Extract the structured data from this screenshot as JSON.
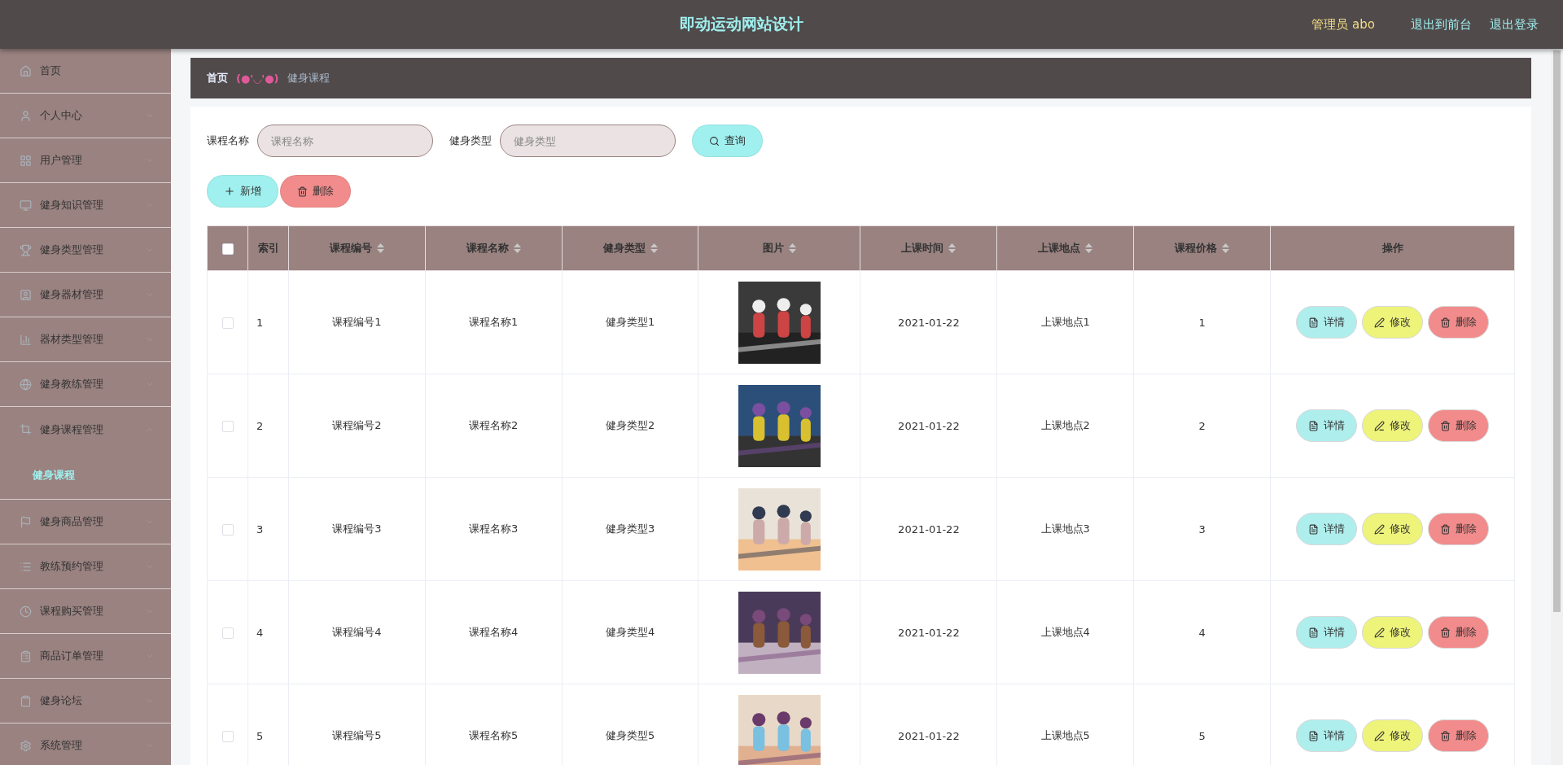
{
  "header": {
    "title": "即动运动网站设计",
    "user": "管理员 abo",
    "links": [
      "退出到前台",
      "退出登录"
    ]
  },
  "sidebar": {
    "items": [
      {
        "label": "首页",
        "kind": "link",
        "expanded": false
      },
      {
        "label": "个人中心",
        "kind": "menu",
        "expanded": false
      },
      {
        "label": "用户管理",
        "kind": "menu",
        "expanded": false
      },
      {
        "label": "健身知识管理",
        "kind": "menu",
        "expanded": false
      },
      {
        "label": "健身类型管理",
        "kind": "menu",
        "expanded": false
      },
      {
        "label": "健身器材管理",
        "kind": "menu",
        "expanded": false
      },
      {
        "label": "器材类型管理",
        "kind": "menu",
        "expanded": false
      },
      {
        "label": "健身教练管理",
        "kind": "menu",
        "expanded": false
      },
      {
        "label": "健身课程管理",
        "kind": "menu",
        "expanded": true,
        "children": [
          {
            "label": "健身课程",
            "selected": true
          }
        ]
      },
      {
        "label": "健身商品管理",
        "kind": "menu",
        "expanded": false
      },
      {
        "label": "教练预约管理",
        "kind": "menu",
        "expanded": false
      },
      {
        "label": "课程购买管理",
        "kind": "menu",
        "expanded": false
      },
      {
        "label": "商品订单管理",
        "kind": "menu",
        "expanded": false
      },
      {
        "label": "健身论坛",
        "kind": "menu",
        "expanded": false
      },
      {
        "label": "系统管理",
        "kind": "menu",
        "expanded": false
      }
    ]
  },
  "breadcrumb": {
    "home": "首页",
    "separator": "(●'◡'●)",
    "current": "健身课程"
  },
  "search": {
    "fields": [
      {
        "label": "课程名称",
        "placeholder": "课程名称"
      },
      {
        "label": "健身类型",
        "placeholder": "健身类型"
      }
    ],
    "button": "查询"
  },
  "toolbar": [
    {
      "label": "新增",
      "kind": "add"
    },
    {
      "label": "删除",
      "kind": "delete"
    }
  ],
  "table": {
    "select_all": {
      "checked": false
    },
    "columns": [
      {
        "label": "索引",
        "sortable": false
      },
      {
        "label": "课程编号",
        "sortable": true
      },
      {
        "label": "课程名称",
        "sortable": true
      },
      {
        "label": "健身类型",
        "sortable": true
      },
      {
        "label": "图片",
        "sortable": true
      },
      {
        "label": "上课时间",
        "sortable": true
      },
      {
        "label": "上课地点",
        "sortable": true
      },
      {
        "label": "课程价格",
        "sortable": true
      },
      {
        "label": "操作",
        "sortable": false
      }
    ],
    "rows": [
      {
        "checked": false,
        "index": "1",
        "code": "课程编号1",
        "name": "课程名称1",
        "type": "健身类型1",
        "time": "2021-01-22",
        "place": "上课地点1",
        "price": "1",
        "actions": [
          {
            "label": "详情",
            "kind": "detail"
          },
          {
            "label": "修改",
            "kind": "edit"
          },
          {
            "label": "删除",
            "kind": "delete"
          }
        ]
      },
      {
        "checked": false,
        "index": "2",
        "code": "课程编号2",
        "name": "课程名称2",
        "type": "健身类型2",
        "time": "2021-01-22",
        "place": "上课地点2",
        "price": "2",
        "actions": [
          {
            "label": "详情",
            "kind": "detail"
          },
          {
            "label": "修改",
            "kind": "edit"
          },
          {
            "label": "删除",
            "kind": "delete"
          }
        ]
      },
      {
        "checked": false,
        "index": "3",
        "code": "课程编号3",
        "name": "课程名称3",
        "type": "健身类型3",
        "time": "2021-01-22",
        "place": "上课地点3",
        "price": "3",
        "actions": [
          {
            "label": "详情",
            "kind": "detail"
          },
          {
            "label": "修改",
            "kind": "edit"
          },
          {
            "label": "删除",
            "kind": "delete"
          }
        ]
      },
      {
        "checked": false,
        "index": "4",
        "code": "课程编号4",
        "name": "课程名称4",
        "type": "健身类型4",
        "time": "2021-01-22",
        "place": "上课地点4",
        "price": "4",
        "actions": [
          {
            "label": "详情",
            "kind": "detail"
          },
          {
            "label": "修改",
            "kind": "edit"
          },
          {
            "label": "删除",
            "kind": "delete"
          }
        ]
      },
      {
        "checked": false,
        "index": "5",
        "code": "课程编号5",
        "name": "课程名称5",
        "type": "健身类型5",
        "time": "2021-01-22",
        "place": "上课地点5",
        "price": "5",
        "actions": [
          {
            "label": "详情",
            "kind": "detail"
          },
          {
            "label": "修改",
            "kind": "edit"
          },
          {
            "label": "删除",
            "kind": "delete"
          }
        ]
      }
    ]
  }
}
